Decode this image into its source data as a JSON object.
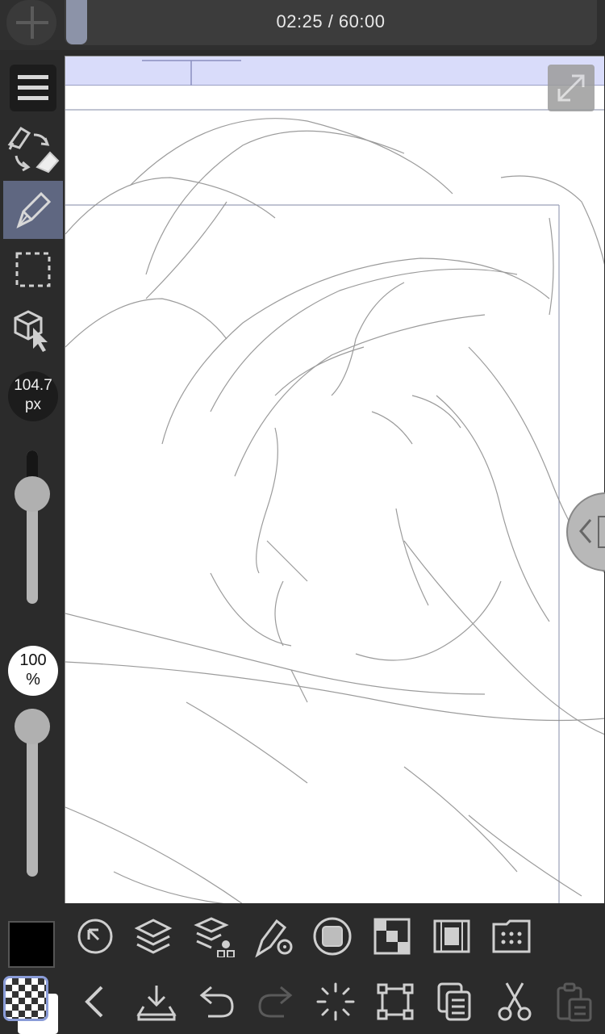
{
  "app": {
    "timer": {
      "elapsed": "02:25",
      "total": "60:00",
      "separator": " / "
    }
  },
  "left_toolbar": {
    "brush_size": {
      "value": "104.7",
      "unit": "px",
      "slider_fraction": 0.22
    },
    "opacity": {
      "value": "100",
      "unit": "%",
      "slider_fraction": 1.0
    },
    "tools": [
      {
        "name": "menu-icon"
      },
      {
        "name": "pen-eraser-swap-icon"
      },
      {
        "name": "pen-icon",
        "active": true
      },
      {
        "name": "selection-icon"
      },
      {
        "name": "object-select-icon"
      }
    ],
    "main_color": "#000000"
  },
  "palette_row": {
    "items": [
      {
        "name": "navigator-icon"
      },
      {
        "name": "layers-icon"
      },
      {
        "name": "layer-property-icon"
      },
      {
        "name": "tool-property-icon"
      },
      {
        "name": "color-icon"
      },
      {
        "name": "material-icon"
      },
      {
        "name": "animation-timeline-icon"
      },
      {
        "name": "sub-view-icon"
      }
    ]
  },
  "command_row": {
    "items": [
      {
        "name": "back-icon"
      },
      {
        "name": "save-icon"
      },
      {
        "name": "undo-icon"
      },
      {
        "name": "redo-icon",
        "disabled": true
      },
      {
        "name": "loading-icon"
      },
      {
        "name": "transform-icon"
      },
      {
        "name": "copy-icon"
      },
      {
        "name": "cut-icon"
      },
      {
        "name": "paste-icon",
        "disabled": true
      }
    ]
  },
  "colors": {
    "accent": "#5f6781",
    "panel": "#2b2b2b",
    "canvas": "#ffffff",
    "band": "#d9dcfa"
  }
}
